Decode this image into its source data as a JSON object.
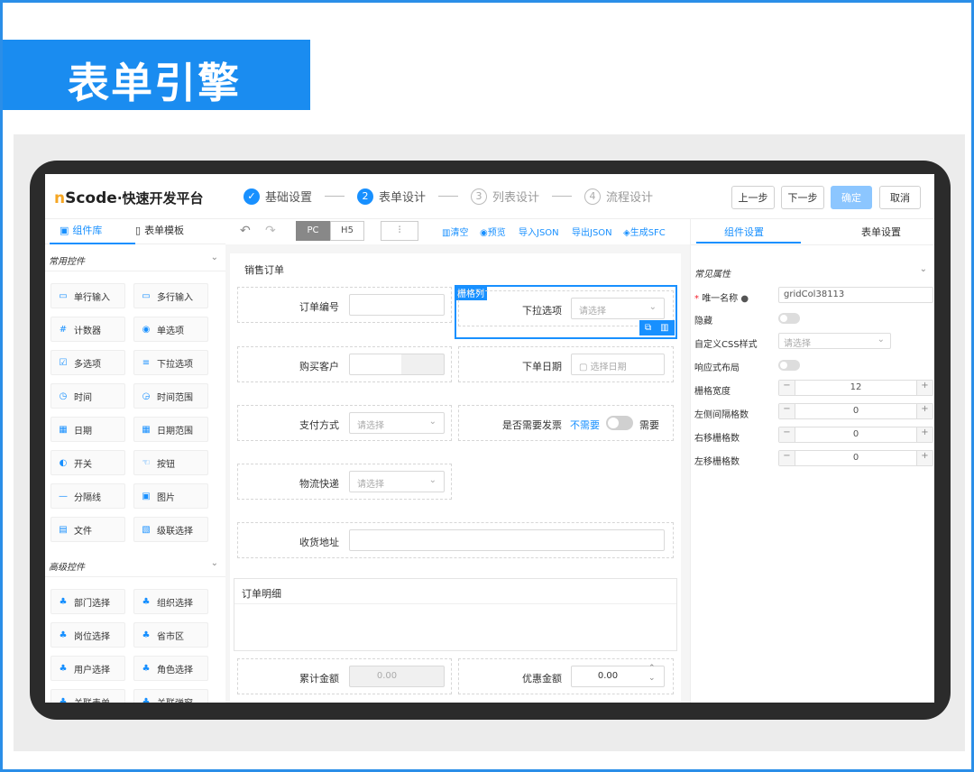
{
  "banner": {
    "title": "表单引擎"
  },
  "app": {
    "logo_m": "n",
    "logo_brand": "Scode",
    "logo_sep": "·",
    "logo_sub": "快速开发平台"
  },
  "steps": [
    {
      "num": "✓",
      "label": "基础设置"
    },
    {
      "num": "2",
      "label": "表单设计"
    },
    {
      "num": "3",
      "label": "列表设计"
    },
    {
      "num": "4",
      "label": "流程设计"
    }
  ],
  "actions": {
    "prev": "上一步",
    "next": "下一步",
    "confirm": "确定",
    "cancel": "取消"
  },
  "left_tabs": {
    "components": "组件库",
    "templates": "表单模板"
  },
  "sections": {
    "common": "常用控件",
    "advanced": "高级控件"
  },
  "components": [
    "单行输入",
    "多行输入",
    "计数器",
    "单选项",
    "多选项",
    "下拉选项",
    "时间",
    "时间范围",
    "日期",
    "日期范围",
    "开关",
    "按钮",
    "分隔线",
    "图片",
    "文件",
    "级联选择"
  ],
  "advanced_components": [
    "部门选择",
    "组织选择",
    "岗位选择",
    "省市区",
    "用户选择",
    "角色选择",
    "关联表单",
    "关联弹窗"
  ],
  "toolbar": {
    "pc": "PC",
    "h5": "H5",
    "clear": "清空",
    "preview": "预览",
    "import": "导入JSON",
    "export": "导出JSON",
    "gen": "生成SFC"
  },
  "form": {
    "title": "销售订单",
    "order_no": "订单编号",
    "grid_tag": "栅格列",
    "dropdown": "下拉选项",
    "dropdown_ph": "请选择",
    "customer": "购买客户",
    "date_label": "下单日期",
    "date_ph": "选择日期",
    "pay": "支付方式",
    "pay_ph": "请选择",
    "invoice": "是否需要发票",
    "invoice_off": "不需要",
    "invoice_on": "需要",
    "logistics": "物流快递",
    "logistics_ph": "请选择",
    "address": "收货地址",
    "details": "订单明细",
    "total": "累计金额",
    "total_val": "0.00",
    "discount": "优惠金额",
    "discount_val": "0.00"
  },
  "right_tabs": {
    "component": "组件设置",
    "form": "表单设置"
  },
  "props": {
    "header": "常见属性",
    "unique_name": "唯一名称",
    "unique_val": "gridCol38113",
    "hidden": "隐藏",
    "css": "自定义CSS样式",
    "css_ph": "请选择",
    "responsive": "响应式布局",
    "width": "栅格宽度",
    "width_val": "12",
    "left_gap": "左侧间隔格数",
    "left_gap_val": "0",
    "right_shift": "右移栅格数",
    "right_shift_val": "0",
    "left_shift": "左移栅格数",
    "left_shift_val": "0"
  },
  "colors": {
    "accent": "#1890ff",
    "banner": "#1a8cf0",
    "logo": "#f5a623"
  }
}
